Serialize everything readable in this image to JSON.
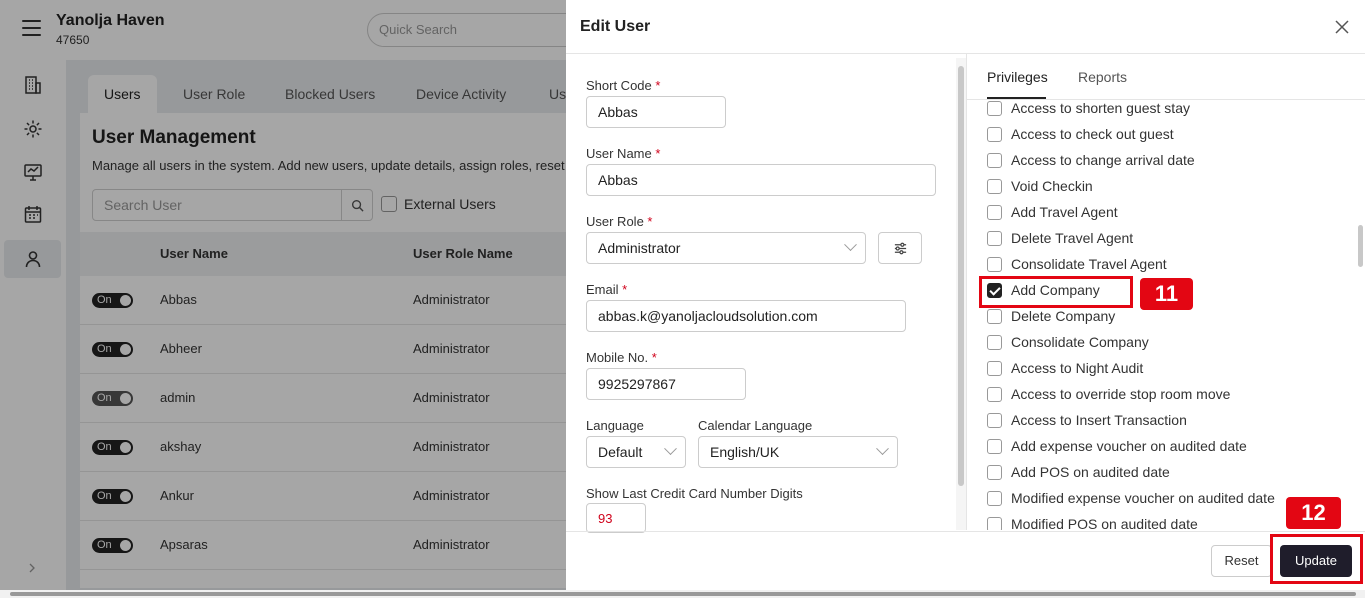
{
  "header": {
    "hotel_name": "Yanolja Haven",
    "hotel_id": "47650",
    "quick_search_placeholder": "Quick Search"
  },
  "sidebar": {
    "items": [
      {
        "icon": "building-icon"
      },
      {
        "icon": "gear-icon"
      },
      {
        "icon": "monitor-icon"
      },
      {
        "icon": "calendar-icon"
      },
      {
        "icon": "user-icon",
        "active": true
      }
    ],
    "expand_icon": "chevron-right-icon"
  },
  "main": {
    "tabs": [
      "Users",
      "User Role",
      "Blocked Users",
      "Device Activity",
      "Us"
    ],
    "active_tab": "Users",
    "title": "User Management",
    "description": "Manage all users in the system. Add new users, update details, assign roles, reset p",
    "search_placeholder": "Search User",
    "external_users_label": "External Users",
    "columns": [
      "User Name",
      "User Role Name"
    ],
    "rows": [
      {
        "toggle": "On",
        "name": "Abbas",
        "role": "Administrator"
      },
      {
        "toggle": "On",
        "name": "Abheer",
        "role": "Administrator"
      },
      {
        "toggle": "On",
        "name": "admin",
        "role": "Administrator"
      },
      {
        "toggle": "On",
        "name": "akshay",
        "role": "Administrator"
      },
      {
        "toggle": "On",
        "name": "Ankur",
        "role": "Administrator"
      },
      {
        "toggle": "On",
        "name": "Apsaras",
        "role": "Administrator"
      }
    ]
  },
  "modal": {
    "title": "Edit User",
    "fields": {
      "short_code": {
        "label": "Short Code",
        "req": "*",
        "value": "Abbas"
      },
      "user_name": {
        "label": "User Name",
        "req": "*",
        "value": "Abbas"
      },
      "user_role": {
        "label": "User Role",
        "req": "*",
        "value": "Administrator"
      },
      "email": {
        "label": "Email",
        "req": "*",
        "value": "abbas.k@yanoljacloudsolution.com"
      },
      "mobile": {
        "label": "Mobile No.",
        "req": "*",
        "value": "9925297867"
      },
      "language": {
        "label": "Language",
        "value": "Default"
      },
      "calendar_language": {
        "label": "Calendar Language",
        "value": "English/UK"
      },
      "last_cc_digits": {
        "label": "Show Last Credit Card Number Digits",
        "value": "93"
      }
    },
    "right_tabs": {
      "privileges": "Privileges",
      "reports": "Reports"
    },
    "privileges": [
      {
        "label": "Access to shorten guest stay",
        "checked": false
      },
      {
        "label": "Access to check out guest",
        "checked": false
      },
      {
        "label": "Access to change arrival date",
        "checked": false
      },
      {
        "label": "Void Checkin",
        "checked": false
      },
      {
        "label": "Add Travel Agent",
        "checked": false
      },
      {
        "label": "Delete Travel Agent",
        "checked": false
      },
      {
        "label": "Consolidate Travel Agent",
        "checked": false
      },
      {
        "label": "Add Company",
        "checked": true
      },
      {
        "label": "Delete Company",
        "checked": false
      },
      {
        "label": "Consolidate Company",
        "checked": false
      },
      {
        "label": "Access to Night Audit",
        "checked": false
      },
      {
        "label": "Access to override stop room move",
        "checked": false
      },
      {
        "label": "Access to Insert Transaction",
        "checked": false
      },
      {
        "label": "Add expense voucher on audited date",
        "checked": false
      },
      {
        "label": "Add POS on audited date",
        "checked": false
      },
      {
        "label": "Modified expense voucher on audited date",
        "checked": false
      },
      {
        "label": "Modified POS on audited date",
        "checked": false
      }
    ],
    "reset_label": "Reset",
    "update_label": "Update"
  },
  "annotations": {
    "step_11": "11",
    "step_12": "12",
    "color": "#e30613"
  }
}
